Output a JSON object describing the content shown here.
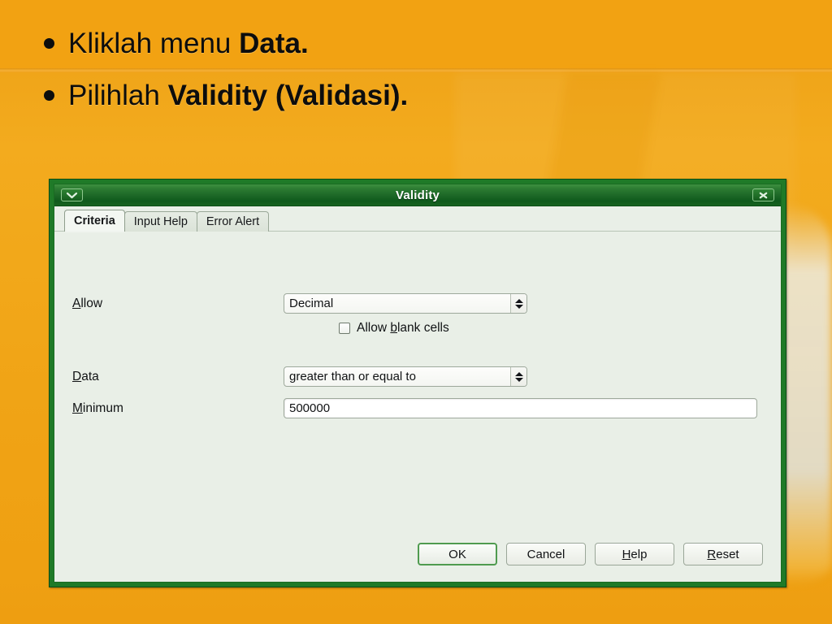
{
  "slide": {
    "background_color": "#f0a013",
    "bullets": [
      {
        "marker": "•",
        "prefix": "Kliklah menu ",
        "bold": "Data.",
        "suffix": ""
      },
      {
        "marker": "•",
        "prefix": "Pilihlah ",
        "bold": "Validity (Validasi).",
        "suffix": ""
      }
    ]
  },
  "dialog": {
    "title": "Validity",
    "titlebar": {
      "shade_icon": "chevron-down-icon",
      "close_icon": "close-icon"
    },
    "frame_color": "#1f7a28",
    "body_color": "#e9efe7",
    "tabs": [
      {
        "label": "Criteria",
        "active": true
      },
      {
        "label": "Input Help",
        "active": false
      },
      {
        "label": "Error Alert",
        "active": false
      }
    ],
    "criteria": {
      "allow": {
        "label_pre": "A",
        "label_accel": "A",
        "label": "Allow",
        "label_rest": "llow",
        "value": "Decimal",
        "spinner_up_icon": "triangle-up-icon",
        "spinner_down_icon": "triangle-down-icon"
      },
      "allow_blank": {
        "label_pre": "Allow ",
        "label_accel": "b",
        "label_rest": "lank cells",
        "checked": false
      },
      "data": {
        "label_accel": "D",
        "label_rest": "ata",
        "value": "greater than or equal to"
      },
      "minimum": {
        "label_accel": "M",
        "label_rest": "inimum",
        "value": "500000",
        "placeholder": ""
      }
    },
    "buttons": [
      {
        "name": "ok",
        "pre": "",
        "accel": "",
        "rest": "OK",
        "default": true
      },
      {
        "name": "cancel",
        "pre": "",
        "accel": "",
        "rest": "Cancel",
        "default": false
      },
      {
        "name": "help",
        "pre": "",
        "accel": "H",
        "rest": "elp",
        "default": false
      },
      {
        "name": "reset",
        "pre": "",
        "accel": "R",
        "rest": "eset",
        "default": false
      }
    ]
  }
}
